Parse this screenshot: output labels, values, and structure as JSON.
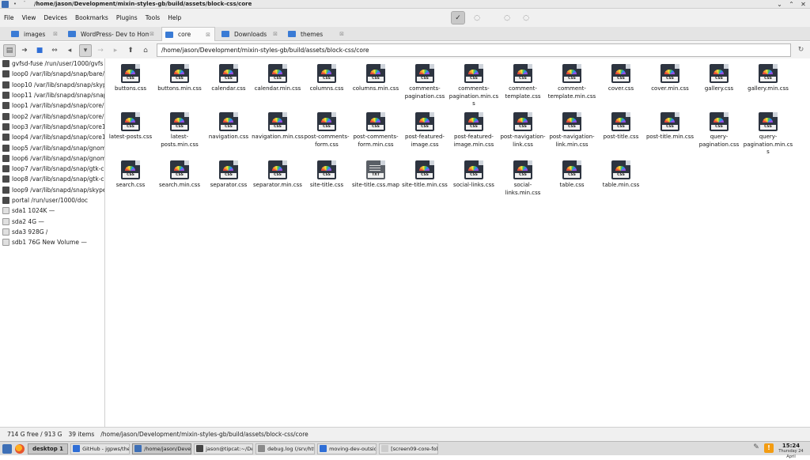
{
  "window": {
    "title": "/home/jason/Development/mixin-styles-gb/build/assets/block-css/core"
  },
  "menu": [
    "File",
    "View",
    "Devices",
    "Bookmarks",
    "Plugins",
    "Tools",
    "Help"
  ],
  "tabs": [
    {
      "label": "images",
      "active": false
    },
    {
      "label": "WordPress- Dev to Home 2",
      "active": false
    },
    {
      "label": "core",
      "active": true
    },
    {
      "label": "Downloads",
      "active": false
    },
    {
      "label": "themes",
      "active": false
    }
  ],
  "path": {
    "value": "/home/jason/Development/mixin-styles-gb/build/assets/block-css/core"
  },
  "devices": [
    {
      "label": "gvfsd-fuse /run/user/1000/gvfs",
      "icon": "drive-icon"
    },
    {
      "label": "loop0 /var/lib/snapd/snap/bare/5",
      "icon": "drive-icon"
    },
    {
      "label": "loop10 /var/lib/snapd/snap/skype/3",
      "icon": "drive-icon"
    },
    {
      "label": "loop11 /var/lib/snapd/snap/snapd/2",
      "icon": "drive-icon"
    },
    {
      "label": "loop1 /var/lib/snapd/snap/core/162",
      "icon": "drive-icon"
    },
    {
      "label": "loop2 /var/lib/snapd/snap/core/172",
      "icon": "drive-icon"
    },
    {
      "label": "loop3 /var/lib/snapd/snap/core18/2",
      "icon": "drive-icon"
    },
    {
      "label": "loop4 /var/lib/snapd/snap/core18/2",
      "icon": "drive-icon"
    },
    {
      "label": "loop5 /var/lib/snapd/snap/gnome-3",
      "icon": "drive-icon"
    },
    {
      "label": "loop6 /var/lib/snapd/snap/gnome-3",
      "icon": "drive-icon"
    },
    {
      "label": "loop7 /var/lib/snapd/snap/gtk-comr",
      "icon": "drive-icon"
    },
    {
      "label": "loop8 /var/lib/snapd/snap/gtk-comr",
      "icon": "drive-icon"
    },
    {
      "label": "loop9 /var/lib/snapd/snap/skype/37",
      "icon": "drive-icon"
    },
    {
      "label": "portal /run/user/1000/doc",
      "icon": "drive-icon"
    },
    {
      "label": "sda1 1024K —",
      "icon": "disk-icon"
    },
    {
      "label": "sda2 4G —",
      "icon": "disk-icon"
    },
    {
      "label": "sda3 928G /",
      "icon": "disk-icon"
    },
    {
      "label": "sdb1 76G New Volume —",
      "icon": "disk-icon"
    }
  ],
  "files": [
    "buttons.css",
    "buttons.min.css",
    "calendar.css",
    "calendar.min.css",
    "columns.css",
    "columns.min.css",
    "comments-pagination.css",
    "comments-pagination.min.css",
    "comment-template.css",
    "comment-template.min.css",
    "cover.css",
    "cover.min.css",
    "gallery.css",
    "gallery.min.css",
    "latest-posts.css",
    "latest-posts.min.css",
    "navigation.css",
    "navigation.min.css",
    "post-comments-form.css",
    "post-comments-form.min.css",
    "post-featured-image.css",
    "post-featured-image.min.css",
    "post-navigation-link.css",
    "post-navigation-link.min.css",
    "post-title.css",
    "post-title.min.css",
    "query-pagination.css",
    "query-pagination.min.css",
    "search.css",
    "search.min.css",
    "separator.css",
    "separator.min.css",
    "site-title.css",
    "site-title.css.map",
    "site-title.min.css",
    "social-links.css",
    "social-links.min.css",
    "table.css",
    "table.min.css"
  ],
  "file_type_label": {
    "css": "CSS",
    "txt": "TXT"
  },
  "status": {
    "free": "714 G free / 913 G",
    "count": "39 items",
    "path": "/home/jason/Development/mixin-styles-gb/build/assets/block-css/core"
  },
  "taskbar": {
    "desktop": "desktop 1",
    "tasks": [
      {
        "label": "GitHub - jgpws/the-...",
        "color": "#2f6ed6",
        "active": false
      },
      {
        "label": "/home/jason/Devel...",
        "color": "#3d6fb6",
        "active": true
      },
      {
        "label": "jason@tipcat:~/Dev...",
        "color": "#444444",
        "active": false
      },
      {
        "label": "debug.log (/srv/htt...",
        "color": "#8a8a8a",
        "active": false
      },
      {
        "label": "moving-dev-outside...",
        "color": "#2f6ed6",
        "active": false
      },
      {
        "label": "[screen09-core-fold...",
        "color": "#cccccc",
        "active": false
      }
    ],
    "time": "15:24",
    "date": "Thursday 24 April"
  }
}
